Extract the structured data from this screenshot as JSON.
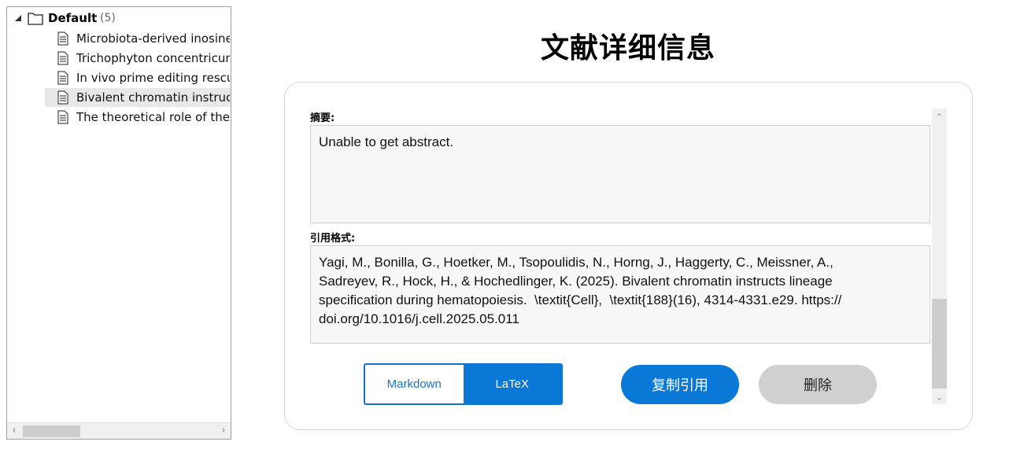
{
  "tree": {
    "root_label": "Default",
    "root_count": "(5)",
    "items": [
      {
        "label": "Microbiota-derived inosine"
      },
      {
        "label": "Trichophyton concentricum"
      },
      {
        "label": "In vivo prime editing rescue"
      },
      {
        "label": "Bivalent chromatin instructs"
      },
      {
        "label": "The theoretical role of the w"
      }
    ],
    "selected_index": 3
  },
  "detail": {
    "title": "文献详细信息",
    "abstract_label": "摘要:",
    "abstract_text": "Unable to get abstract.",
    "citation_label": "引用格式:",
    "citation_text": "Yagi, M., Bonilla, G., Hoetker, M., Tsopoulidis, N., Horng, J., Haggerty, C., Meissner, A.,\nSadreyev, R., Hock, H., & Hochedlinger, K. (2025). Bivalent chromatin instructs lineage\nspecification during hematopoiesis.  \\textit{Cell},  \\textit{188}(16), 4314-4331.e29. https://\ndoi.org/10.1016/j.cell.2025.05.011",
    "format_options": [
      {
        "label": "Markdown",
        "active": false
      },
      {
        "label": "LaTeX",
        "active": true
      }
    ],
    "copy_button": "复制引用",
    "delete_button": "删除"
  },
  "colors": {
    "accent": "#0a78d7",
    "delete_bg": "#d0d0d0"
  }
}
